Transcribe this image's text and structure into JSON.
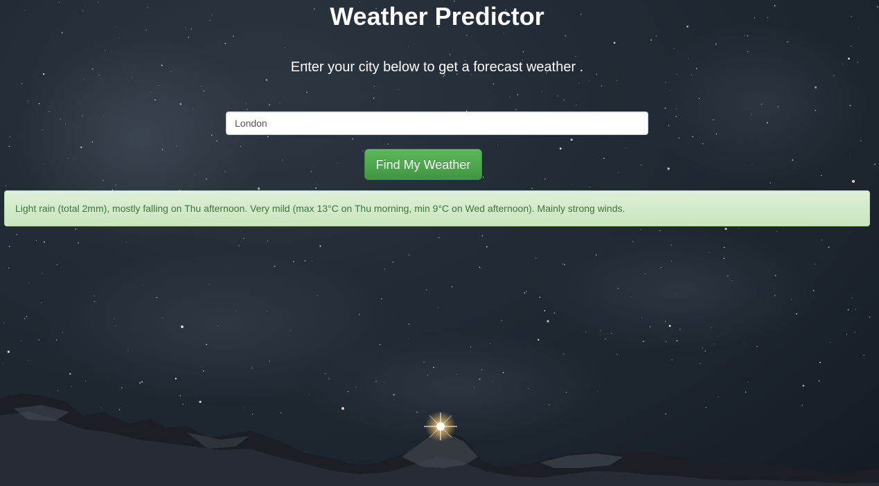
{
  "page": {
    "title": "Weather Predictor",
    "subtitle": "Enter your city below to get a forecast weather ."
  },
  "search": {
    "value": "London"
  },
  "actions": {
    "find_label": "Find My Weather"
  },
  "result": {
    "text": "Light rain (total 2mm), mostly falling on Thu afternoon. Very mild (max 13°C on Thu morning, min 9°C on Wed afternoon). Mainly strong winds."
  },
  "theme": {
    "button_color": "#5cb85c",
    "alert_background": "#dff0d8",
    "alert_text": "#3c763d",
    "background": "#1c242d"
  }
}
